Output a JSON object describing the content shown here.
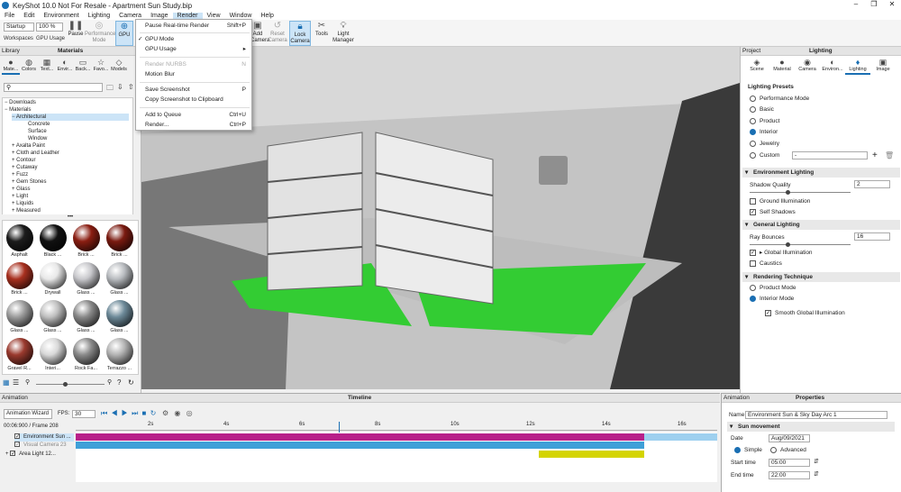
{
  "window": {
    "title": "KeyShot 10.0 Not For Resale - Apartment Sun Study.bip"
  },
  "menu": [
    "File",
    "Edit",
    "Environment",
    "Lighting",
    "Camera",
    "Image",
    "Render",
    "View",
    "Window",
    "Help"
  ],
  "toolbar": {
    "workspace_select": "Startup",
    "zoom_select": "100 %",
    "workspaces_label": "Workspaces",
    "gpu_usage_label": "GPU Usage",
    "pause_label": "Pause",
    "performance_mode_label": "Performance Mode",
    "gpu_label": "GPU",
    "add_camera_label": "Add Camera",
    "reset_camera_label": "Reset Camera",
    "lock_camera_label": "Lock Camera",
    "tools_label": "Tools",
    "light_manager_label": "Light Manager"
  },
  "render_menu": {
    "items": [
      {
        "label": "Pause Real-time Render",
        "shortcut": "Shift+P",
        "disabled": false
      },
      {
        "label": "GPU Mode",
        "shortcut": "",
        "checked": true
      },
      {
        "label": "GPU Usage",
        "shortcut": "▸"
      },
      {
        "label": "Render NURBS",
        "shortcut": "N",
        "disabled": true
      },
      {
        "label": "Motion Blur",
        "shortcut": ""
      },
      {
        "label": "Save Screenshot",
        "shortcut": "P"
      },
      {
        "label": "Copy Screenshot to Clipboard",
        "shortcut": ""
      },
      {
        "label": "Add to Queue",
        "shortcut": "Ctrl+U"
      },
      {
        "label": "Render...",
        "shortcut": "Ctrl+P"
      }
    ]
  },
  "library": {
    "header": "Library",
    "title": "Materials",
    "tabs": [
      "Mate...",
      "Colors",
      "Text...",
      "Envir...",
      "Back...",
      "Favo...",
      "Models"
    ],
    "tree": [
      "Downloads",
      "Materials",
      "Architectural",
      "Concrete",
      "Surface",
      "Window",
      "Axalta Paint",
      "Cloth and Leather",
      "Contour",
      "Cutaway",
      "Fuzz",
      "Gem Stones",
      "Glass",
      "Light",
      "Liquids",
      "Measured"
    ],
    "thumbs": [
      {
        "label": "Asphalt",
        "color": "#1c1c1c"
      },
      {
        "label": "Black ...",
        "color": "#111"
      },
      {
        "label": "Brick ...",
        "color": "#8a1e12"
      },
      {
        "label": "Brick ...",
        "color": "#7a1a10"
      },
      {
        "label": "Brick ...",
        "color": "#a8301f"
      },
      {
        "label": "Drywall",
        "color": "#e8e8e8"
      },
      {
        "label": "Glass ...",
        "color": "#c8c8cc"
      },
      {
        "label": "Glass ...",
        "color": "#b9bcc0"
      },
      {
        "label": "Glass ...",
        "color": "#9d9d9d"
      },
      {
        "label": "Glass ...",
        "color": "#c0c0c0"
      },
      {
        "label": "Glass ...",
        "color": "#8a8a8a"
      },
      {
        "label": "Glass ...",
        "color": "#6d8a99"
      },
      {
        "label": "Gravel R...",
        "color": "#9a3a2e"
      },
      {
        "label": "Interi...",
        "color": "#d8d8d8"
      },
      {
        "label": "Rock Fa...",
        "color": "#8a8a8a"
      },
      {
        "label": "Terrazzo ...",
        "color": "#b3b3b3"
      }
    ]
  },
  "right_panel": {
    "header": "Project",
    "title": "Lighting",
    "tabs": [
      "Scene",
      "Material",
      "Camera",
      "Environ...",
      "Lighting",
      "Image"
    ],
    "lighting_presets_label": "Lighting Presets",
    "presets": [
      "Performance Mode",
      "Basic",
      "Product",
      "Interior",
      "Jewelry",
      "Custom"
    ],
    "custom_value": "-",
    "env_lighting": "Environment Lighting",
    "shadow_quality_label": "Shadow Quality",
    "shadow_quality": "2",
    "ground_illumination": "Ground Illumination",
    "self_shadows": "Self Shadows",
    "general_lighting": "General Lighting",
    "ray_bounces_label": "Ray Bounces",
    "ray_bounces": "16",
    "global_illumination": "Global Illumination",
    "caustics": "Caustics",
    "rendering_technique": "Rendering Technique",
    "product_mode": "Product Mode",
    "interior_mode": "Interior Mode",
    "smooth_gi": "Smooth Global Illumination"
  },
  "animation": {
    "header": "Animation",
    "title": "Timeline",
    "wizard": "Animation Wizard",
    "fps_label": "FPS:",
    "fps": "30",
    "time": "00:06:900 / Frame 208",
    "ticks": [
      "2s",
      "4s",
      "6s",
      "8s",
      "10s",
      "12s",
      "14s",
      "16s"
    ],
    "tracks": [
      "Environment Sun ...",
      "Visual Camera 23",
      "Area Light 12..."
    ]
  },
  "properties": {
    "header": "Animation",
    "title": "Properties",
    "name_label": "Name",
    "name_value": "Environment Sun & Sky Day Arc 1",
    "sun_movement": "Sun movement",
    "date_label": "Date",
    "date_value": "Aug/09/2021",
    "simple": "Simple",
    "advanced": "Advanced",
    "start_label": "Start time",
    "start_value": "05:00",
    "end_label": "End time",
    "end_value": "22:00"
  },
  "colors": {
    "accent": "#1a6fb3",
    "grass": "#33cc33",
    "track_magenta": "#b8208a",
    "track_blue": "#3fa0d8",
    "track_yellow": "#d4d400"
  }
}
